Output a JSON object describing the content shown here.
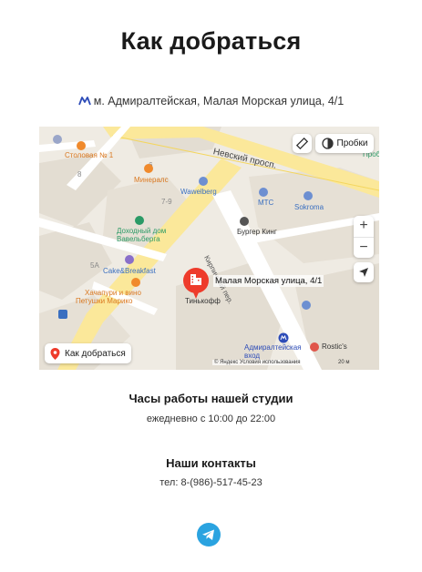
{
  "page": {
    "title": "Как добраться",
    "address": "м. Адмиралтейская, Малая Морская улица, 4/1",
    "address_icon": "metro-icon"
  },
  "map": {
    "traffic_label": "Пробки",
    "route_label": "Как добраться",
    "pin_label": "Малая Морская улица, 4/1",
    "copyright": "© Яндекс  Условия использования",
    "scale": "20 м",
    "zoom_in": "+",
    "zoom_out": "−",
    "labels": {
      "nevsky": "Невский просп.",
      "stolovaya": "Столовая № 1",
      "minerals": "Минералс",
      "wawelberg": "Wawelberg",
      "mts": "МТС",
      "sokroma": "Sokroma",
      "dohodny": "Доходный дом Вавельберга",
      "burger": "Бургер Кинг",
      "cake": "Cake&Breakfast",
      "khachapuri": "Хачапури и вино",
      "petushki": "Петушки Марико",
      "tinkoff": "Тинькофф",
      "kirpichny": "Кирпичный пер.",
      "admiralteyskaya": "Адмиралтейская вход",
      "rostics": "Rostic's",
      "num_6": "6",
      "num_7_9": "7-9",
      "num_5a": "5А",
      "num_8": "8",
      "prob": "Пробк"
    }
  },
  "hours": {
    "title": "Часы работы нашей студии",
    "text": "ежедневно с 10:00 до 22:00"
  },
  "contacts": {
    "title": "Наши контакты",
    "phone": "тел: 8-(986)-517-45-23"
  },
  "social": {
    "icon": "telegram-icon",
    "color": "#2aa3e0"
  },
  "colors": {
    "road_yellow": "#fbe89a",
    "pin_red": "#ee3b2b",
    "metro_blue": "#2d4cb8"
  }
}
